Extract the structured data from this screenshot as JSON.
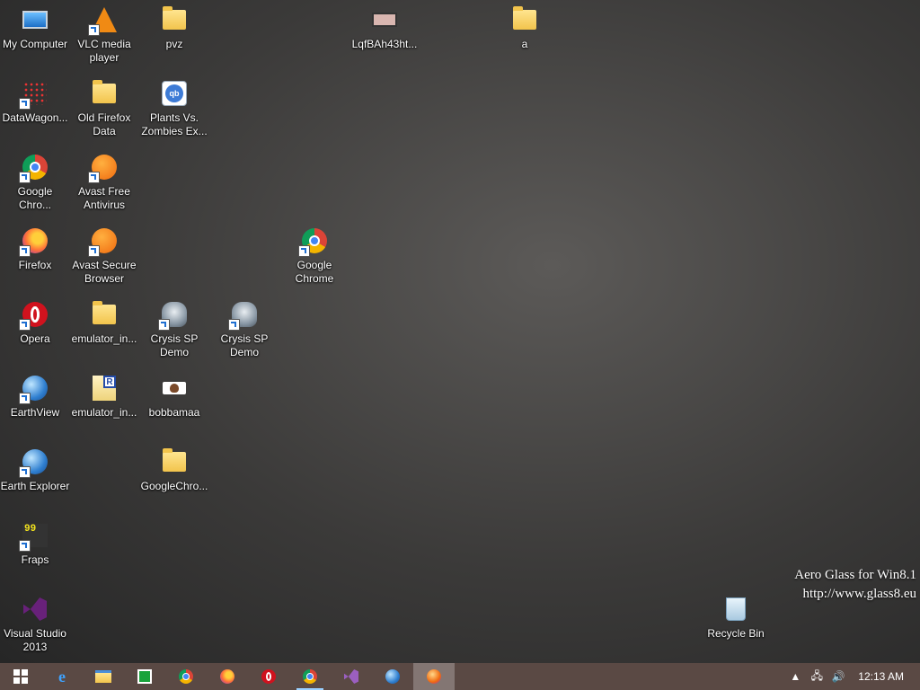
{
  "desktop": {
    "icons": [
      {
        "label": "My Computer",
        "icon": "computer-icon"
      },
      {
        "label": "VLC media player",
        "icon": "vlc-icon"
      },
      {
        "label": "pvz",
        "icon": "folder-icon"
      },
      {
        "label": "LqfBAh43ht...",
        "icon": "image-file-icon"
      },
      {
        "label": "a",
        "icon": "folder-icon"
      },
      {
        "label": "DataWagon...",
        "icon": "datawagon-icon"
      },
      {
        "label": "Old Firefox Data",
        "icon": "folder-icon"
      },
      {
        "label": "Plants Vs. Zombies Ex...",
        "icon": "qbittorrent-file-icon"
      },
      {
        "label": "Google Chro...",
        "icon": "chrome-icon"
      },
      {
        "label": "Avast Free Antivirus",
        "icon": "avast-icon"
      },
      {
        "label": "Firefox",
        "icon": "firefox-icon"
      },
      {
        "label": "Avast Secure Browser",
        "icon": "avast-browser-icon"
      },
      {
        "label": "Google Chrome",
        "icon": "chrome-icon"
      },
      {
        "label": "Opera",
        "icon": "opera-icon"
      },
      {
        "label": "emulator_in...",
        "icon": "folder-icon"
      },
      {
        "label": "Crysis SP Demo",
        "icon": "crysis-icon"
      },
      {
        "label": "Crysis SP Demo",
        "icon": "crysis-icon"
      },
      {
        "label": "EarthView",
        "icon": "earthview-icon"
      },
      {
        "label": "emulator_in...",
        "icon": "rar-file-icon"
      },
      {
        "label": "bobbamaa",
        "icon": "image-file-icon"
      },
      {
        "label": "Earth Explorer",
        "icon": "earth-explorer-icon"
      },
      {
        "label": "GoogleChro...",
        "icon": "folder-icon"
      },
      {
        "label": "Fraps",
        "icon": "fraps-icon"
      },
      {
        "label": "Visual Studio 2013",
        "icon": "visual-studio-icon"
      },
      {
        "label": "Recycle Bin",
        "icon": "recycle-bin-icon"
      }
    ]
  },
  "watermark": {
    "line1": "Aero Glass for Win8.1",
    "line2": "http://www.glass8.eu"
  },
  "taskbar": {
    "buttons": [
      {
        "name": "start-button",
        "icon": "windows-logo-icon",
        "state": "normal"
      },
      {
        "name": "taskbar-internet-explorer",
        "icon": "internet-explorer-icon",
        "state": "normal"
      },
      {
        "name": "taskbar-file-explorer",
        "icon": "file-explorer-icon",
        "state": "normal"
      },
      {
        "name": "taskbar-store",
        "icon": "store-icon",
        "state": "normal"
      },
      {
        "name": "taskbar-chrome",
        "icon": "chrome-icon",
        "state": "normal"
      },
      {
        "name": "taskbar-firefox",
        "icon": "firefox-icon",
        "state": "normal"
      },
      {
        "name": "taskbar-opera",
        "icon": "opera-icon",
        "state": "normal"
      },
      {
        "name": "taskbar-chrome-2",
        "icon": "chrome-icon",
        "state": "running"
      },
      {
        "name": "taskbar-visual-studio",
        "icon": "visual-studio-icon",
        "state": "normal"
      },
      {
        "name": "taskbar-earth",
        "icon": "earth-icon",
        "state": "normal"
      },
      {
        "name": "taskbar-avast-browser",
        "icon": "avast-browser-icon",
        "state": "active"
      }
    ],
    "tray": {
      "chevron": "▲",
      "network": "🖧",
      "volume": "🔊",
      "clock": "12:13 AM"
    }
  },
  "colors": {
    "taskbar": "#4c3a34",
    "label_text": "#ffffff"
  }
}
